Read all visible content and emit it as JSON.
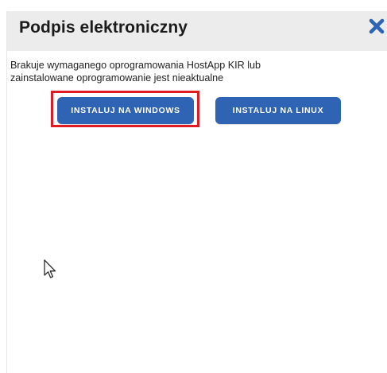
{
  "dialog": {
    "title": "Podpis elektroniczny",
    "close_icon": "close-x-icon",
    "message_line1": "Brakuje wymaganego oprogramowania HostApp KIR lub",
    "message_line2": "zainstalowane oprogramowanie jest nieaktualne",
    "buttons": {
      "install_windows": "INSTALUJ NA WINDOWS",
      "install_linux": "INSTALUJ NA LINUX"
    }
  },
  "colors": {
    "header_bg": "#ececec",
    "button_bg": "#2f63b4",
    "close_icon": "#2f63b4",
    "highlight_border": "#e01b22"
  },
  "cursor": {
    "icon": "mouse-pointer-icon"
  }
}
